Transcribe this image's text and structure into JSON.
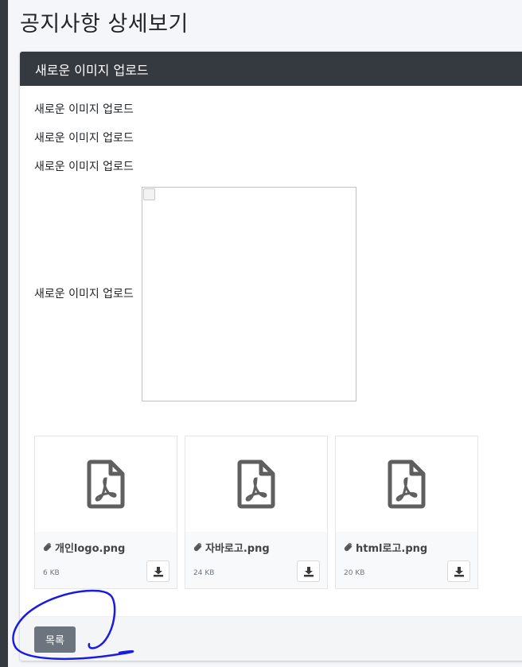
{
  "page": {
    "title": "공지사항 상세보기"
  },
  "card": {
    "header_title": "새로운 이미지 업로드",
    "content_lines": [
      "새로운 이미지 업로드",
      "새로운 이미지 업로드",
      "새로운 이미지 업로드",
      "새로운 이미지 업로드"
    ],
    "inline_image": {
      "state": "broken",
      "icon": "broken-image-icon"
    }
  },
  "attachments": [
    {
      "icon": "pdf-file-icon",
      "name": "개인logo.png",
      "size": "6 KB"
    },
    {
      "icon": "pdf-file-icon",
      "name": "자바로고.png",
      "size": "24 KB"
    },
    {
      "icon": "pdf-file-icon",
      "name": "html로고.png",
      "size": "20 KB"
    }
  ],
  "footer": {
    "list_button_label": "목록"
  },
  "colors": {
    "header_bg": "#343a40",
    "button_bg": "#6c757d",
    "annotation_stroke": "#1a1ae6",
    "icon_gray": "#5f5f5f"
  }
}
